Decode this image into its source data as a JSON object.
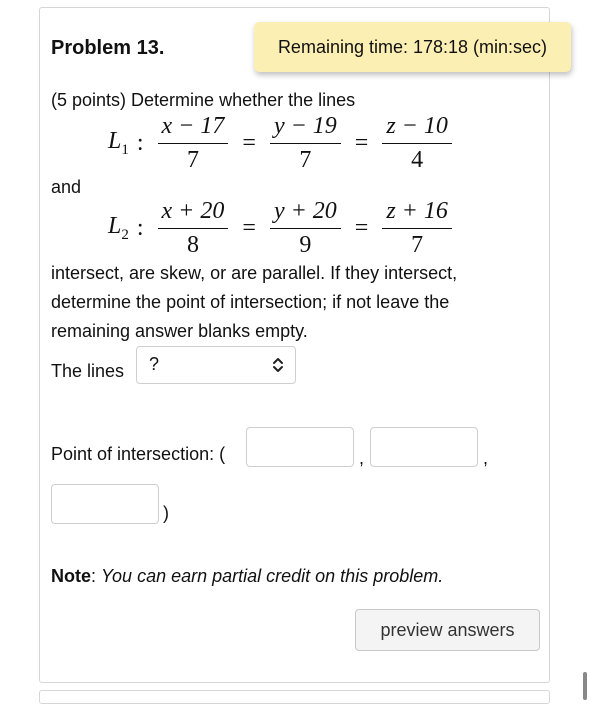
{
  "problem": {
    "title": "Problem 13.",
    "timer": "Remaining time: 178:18 (min:sec)",
    "intro": "(5 points) Determine whether the lines",
    "and": "and",
    "instructions": [
      "intersect, are skew, or are parallel. If they intersect,",
      "determine the point of intersection; if not leave the",
      "remaining answer blanks empty."
    ]
  },
  "line1": {
    "label": "L",
    "sub": "1",
    "colon": ":",
    "eq": "=",
    "fractions": [
      {
        "num": "x − 17",
        "den": "7"
      },
      {
        "num": "y − 19",
        "den": "7"
      },
      {
        "num": "z − 10",
        "den": "4"
      }
    ]
  },
  "line2": {
    "label": "L",
    "sub": "2",
    "colon": ":",
    "eq": "=",
    "fractions": [
      {
        "num": "x + 20",
        "den": "8"
      },
      {
        "num": "y + 20",
        "den": "9"
      },
      {
        "num": "z + 16",
        "den": "7"
      }
    ]
  },
  "answer": {
    "lines_label": "The lines",
    "lines_select_value": "?",
    "point_label": "Point of intersection: (",
    "comma1": ",",
    "comma2": ",",
    "close_paren": ")",
    "point_values": [
      "",
      "",
      ""
    ]
  },
  "note": {
    "label": "Note",
    "colon": ":",
    "text": "You can earn partial credit on this problem."
  },
  "buttons": {
    "preview": "preview answers"
  }
}
